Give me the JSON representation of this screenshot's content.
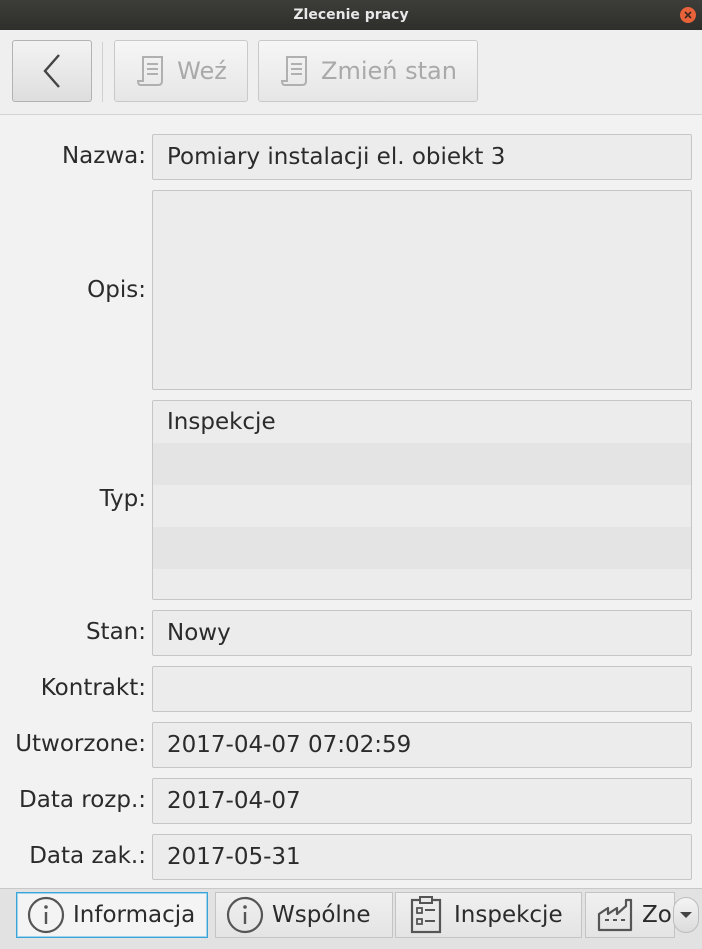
{
  "window": {
    "title": "Zlecenie pracy"
  },
  "toolbar": {
    "back_icon": "chevron-left-icon",
    "take_label": "Weź",
    "change_state_label": "Zmień stan",
    "document_icon": "document-icon"
  },
  "form": {
    "name_label": "Nazwa:",
    "name_value": "Pomiary instalacji el. obiekt 3",
    "description_label": "Opis:",
    "description_value": "",
    "type_label": "Typ:",
    "type_items": [
      "Inspekcje",
      "",
      "",
      "",
      ""
    ],
    "state_label": "Stan:",
    "state_value": "Nowy",
    "contract_label": "Kontrakt:",
    "contract_value": "",
    "created_label": "Utworzone:",
    "created_value": "2017-04-07 07:02:59",
    "start_label": "Data rozp.:",
    "start_value": "2017-04-07",
    "end_label": "Data zak.:",
    "end_value": "2017-05-31"
  },
  "tabs": [
    {
      "label": "Informacja",
      "icon": "info-icon",
      "selected": true
    },
    {
      "label": "Wspólne",
      "icon": "info-icon",
      "selected": false
    },
    {
      "label": "Inspekcje",
      "icon": "checklist-icon",
      "selected": false
    },
    {
      "label": "Zo",
      "icon": "factory-icon",
      "selected": false
    }
  ],
  "tab_overflow_icon": "chevron-down-icon",
  "colors": {
    "selected_tab_border": "#3aa3d8",
    "close_button": "#e9623a",
    "titlebar": "#353532"
  }
}
